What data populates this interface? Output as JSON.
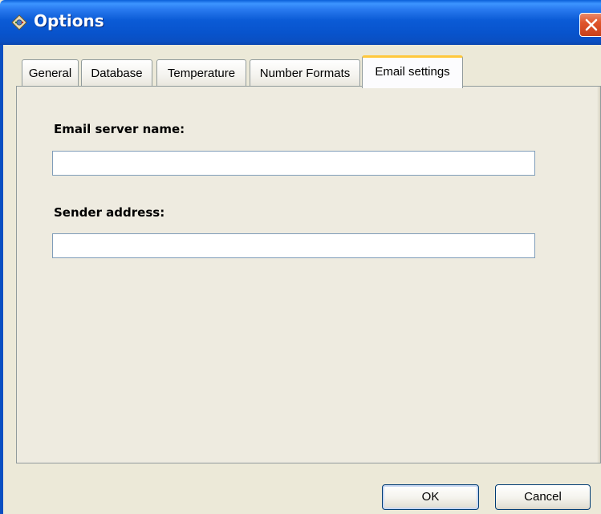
{
  "window": {
    "title": "Options",
    "accent": "#0A4FC2",
    "close_color": "#E0552B"
  },
  "tabs": [
    {
      "label": "General",
      "active": false
    },
    {
      "label": "Database",
      "active": false
    },
    {
      "label": "Temperature",
      "active": false
    },
    {
      "label": "Number Formats",
      "active": false
    },
    {
      "label": "Email settings",
      "active": true
    }
  ],
  "email_settings": {
    "server_label": "Email server name:",
    "server_value": "",
    "sender_label": "Sender address:",
    "sender_value": ""
  },
  "buttons": {
    "ok_label": "OK",
    "cancel_label": "Cancel"
  },
  "icons": {
    "app": "options-gear-icon",
    "close": "close-icon"
  }
}
